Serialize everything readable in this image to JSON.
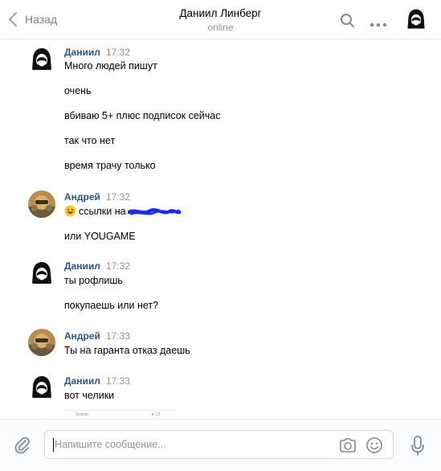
{
  "header": {
    "back_label": "Назад",
    "title": "Даниил Линберг",
    "status": "online"
  },
  "messages": [
    {
      "author": "Даниил",
      "time": "17:32",
      "lines": [
        "Много людей пишут",
        "очень",
        "вбиваю 5+ плюс подписок сейчас",
        "так что нет",
        "время трачу только"
      ]
    },
    {
      "author": "Андрей",
      "time": "17:32",
      "lines": [
        "ссылки на",
        "или YOUGAME"
      ]
    },
    {
      "author": "Даниил",
      "time": "17:32",
      "lines": [
        "ты рофлишь",
        "покупаешь или нет?"
      ]
    },
    {
      "author": "Андрей",
      "time": "17:33",
      "lines": [
        "Ты на гаранта отказ даешь"
      ]
    },
    {
      "author": "Даниил",
      "time": "17:33",
      "lines": [
        "вот челики"
      ]
    }
  ],
  "attachment_preview": {
    "search_text": "Search",
    "rating_text": "★ 12"
  },
  "composer": {
    "placeholder": "Напишите сообщение..."
  },
  "colors": {
    "accent": "#2a5885",
    "muted": "#939393",
    "redaction": "#1a2cf0"
  }
}
